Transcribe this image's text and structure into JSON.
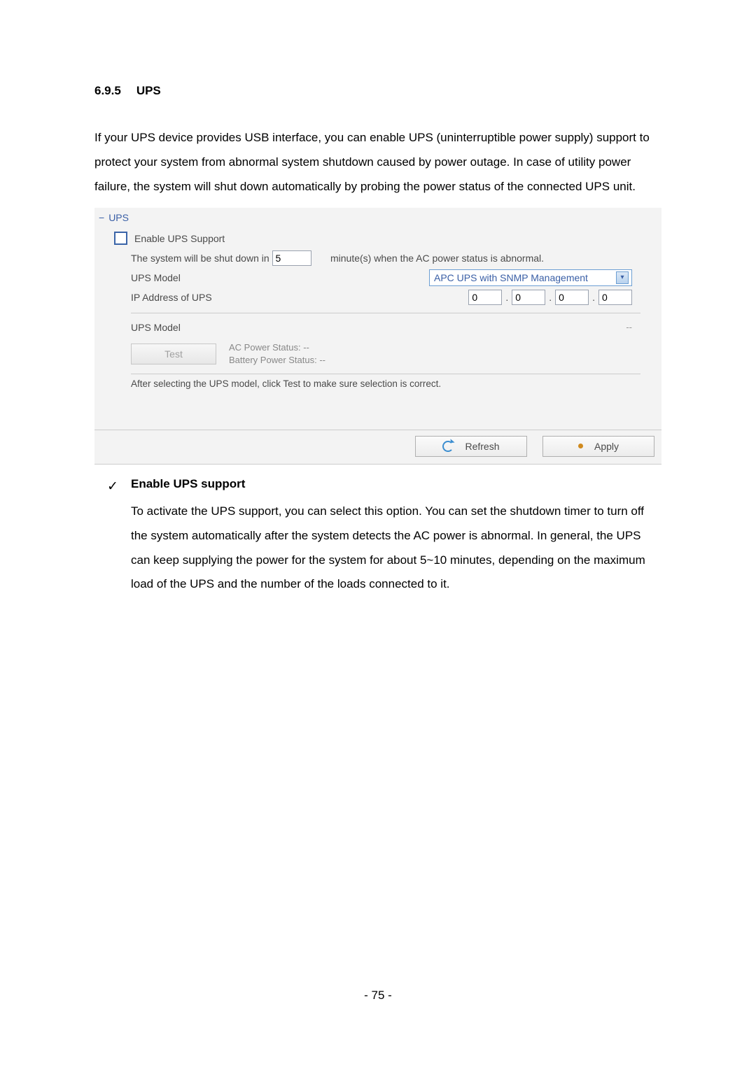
{
  "heading": {
    "number": "6.9.5",
    "title": "UPS"
  },
  "intro": "If your UPS device provides USB interface, you can enable UPS (uninterruptible power supply) support to protect your system from abnormal system shutdown caused by power outage.  In case of utility power failure, the system will shut down automatically by probing the power status of the connected UPS unit.",
  "panel": {
    "header": "UPS",
    "minus": "−",
    "enable_label": "Enable UPS Support",
    "shutdown_pre": "The system will be shut down in",
    "shutdown_value": "5",
    "shutdown_post": "minute(s) when the AC power status is abnormal.",
    "model_label": "UPS Model",
    "model_value": "APC UPS with SNMP Management",
    "ip_label": "IP Address of UPS",
    "ip": {
      "a": "0",
      "b": "0",
      "c": "0",
      "d": "0"
    },
    "model2_label": "UPS Model",
    "dash": "--",
    "test_btn": "Test",
    "ac_status": "AC Power Status: --",
    "batt_status": "Battery Power Status: --",
    "hint": "After selecting the UPS model, click Test to make sure selection is correct.",
    "refresh": "Refresh",
    "apply": "Apply"
  },
  "after": {
    "tick": "✓",
    "subtitle": "Enable UPS support",
    "text": "To activate the UPS support, you can select this option.  You can set the shutdown timer to turn off the system automatically after the system detects the AC power is abnormal.  In general, the UPS can keep supplying the power for the system for about 5~10 minutes, depending on the maximum load of the UPS and the number of the loads connected to it."
  },
  "footer": "- 75 -"
}
